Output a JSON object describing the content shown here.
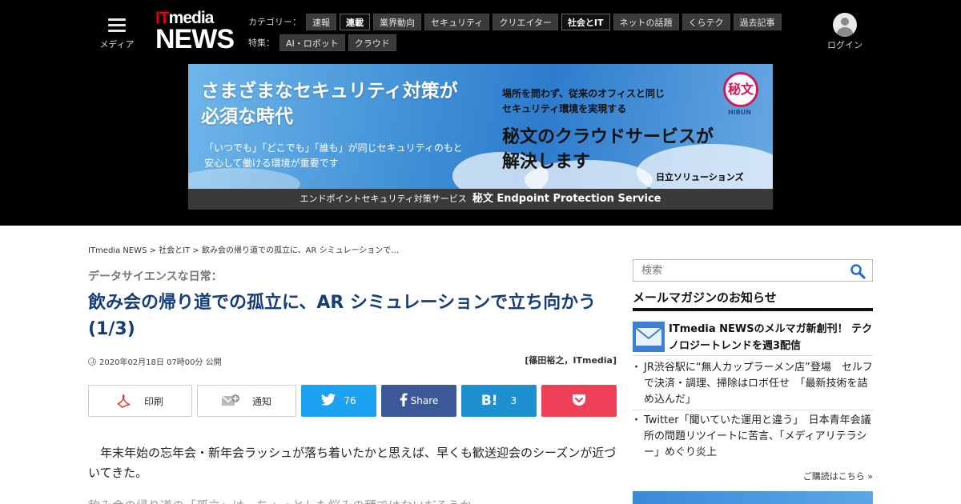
{
  "header": {
    "menu_label": "メディア",
    "logo_it": "IT",
    "logo_media": "media",
    "logo_news": "NEWS",
    "category_label": "カテゴリー：",
    "categories": [
      "速報",
      "連載",
      "業界動向",
      "セキュリティ",
      "クリエイター",
      "社会とIT",
      "ネットの話題",
      "くらテク",
      "過去記事"
    ],
    "feature_label": "特集：",
    "features": [
      "AI・ロボット",
      "クラウド"
    ],
    "login_label": "ログイン"
  },
  "banner": {
    "headline_1": "さまざまなセキュリティ対策が",
    "headline_2": "必須な時代",
    "sub_1": "「いつでも」「どこでも」「誰も」が同じセキュリティのもと",
    "sub_2": "安心して働ける環境が重要です",
    "right_1": "場所を問わず、従来のオフィスと同じ",
    "right_2": "セキュリティ環境を実現する",
    "right_big_1": "秘文のクラウドサービスが",
    "right_big_2": "解決します",
    "company": "日立ソリューションズ",
    "seal": "秘文",
    "seal_caption": "HIBUN",
    "footer_small": "エンドポイントセキュリティ対策サービス",
    "footer_big": "秘文 Endpoint Protection Service"
  },
  "breadcrumb": {
    "home": "ITmedia NEWS",
    "section": "社会とIT",
    "current": "飲み会の帰り道での孤立に、AR シミュレーションで…",
    "sep": " > "
  },
  "article": {
    "kicker": "データサイエンスな日常：",
    "title": "飲み会の帰り道での孤立に、AR シミュレーションで立ち向かう (1/3)",
    "date": "2020年02月18日 07時00分 公開",
    "author": "[篠田裕之，ITmedia]",
    "paragraph_1": "年末年始の忘年会・新年会ラッシュが落ち着いたかと思えば、早くも歓送迎会のシーズンが近づいてきた。",
    "paragraph_2": "飲み会の帰り道の「孤立」は、ちょっとした悩みの種ではないだろうか。"
  },
  "share": {
    "print_label": "印刷",
    "notify_label": "通知",
    "twitter_count": "76",
    "facebook_label": "Share",
    "hatena_icon": "B!",
    "hatena_count": "3"
  },
  "sidebar": {
    "search_placeholder": "検索",
    "newsletter_heading": "メールマガジンのお知らせ",
    "newsletter_title": "ITmedia NEWSのメルマガ新創刊！ テクノロジートレンドを週3配信",
    "news_1": "JR渋谷駅に“無人カップラーメン店”登場　セルフで決済・調理、掃除はロボ任せ　「最新技術を詰め込んだ」",
    "news_2": "Twitter「聞いていた運用と違う」　日本青年会議所の問題リツイートに苦言、「メディアリテラシー」めぐり炎上",
    "more_label": "ご購読はこちら »"
  },
  "colors": {
    "title": "#153d7a",
    "twitter": "#1da1f2",
    "facebook": "#3b5998",
    "hatena": "#1e90d0",
    "pocket": "#ee4056",
    "logo_accent": "#e60012"
  }
}
